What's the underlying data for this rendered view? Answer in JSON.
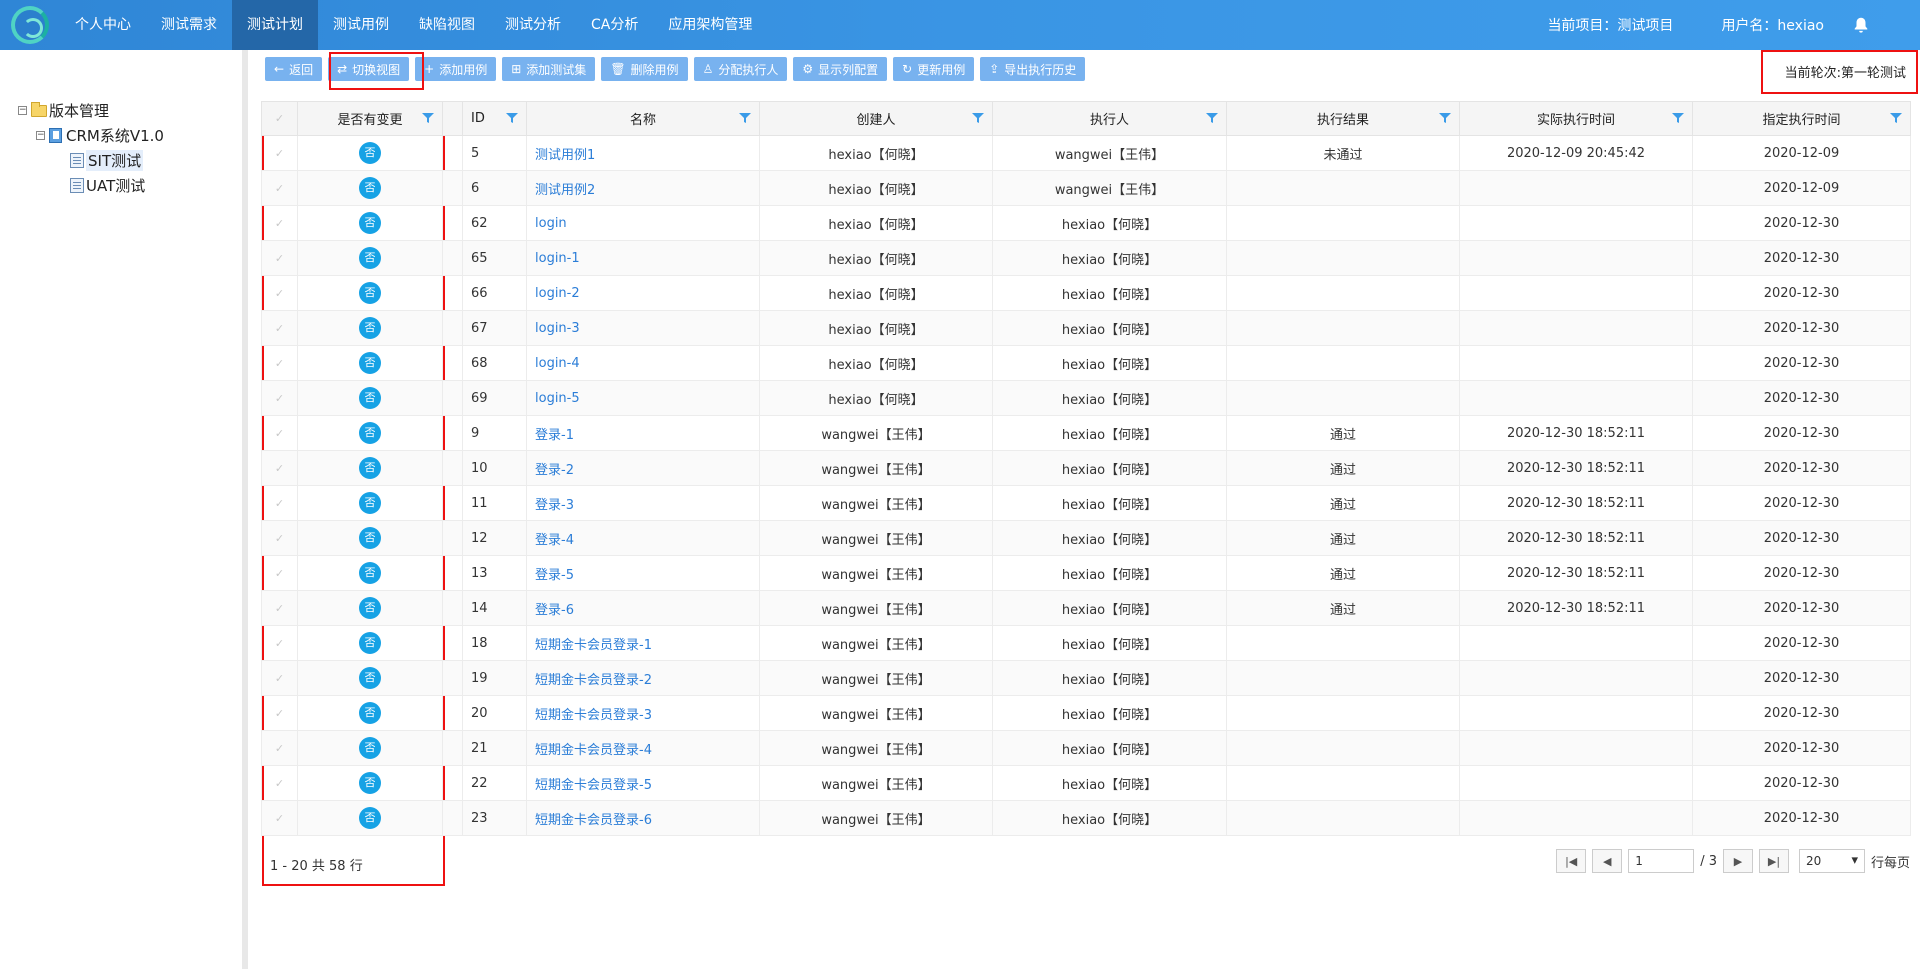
{
  "nav": {
    "items": [
      "个人中心",
      "测试需求",
      "测试计划",
      "测试用例",
      "缺陷视图",
      "测试分析",
      "CA分析",
      "应用架构管理"
    ],
    "active_index": 2,
    "project": "当前项目：测试项目",
    "user": "用户名：hexiao"
  },
  "tree": {
    "root": "版本管理",
    "version": "CRM系统V1.0",
    "children": [
      "SIT测试",
      "UAT测试"
    ]
  },
  "toolbar": {
    "buttons": [
      {
        "icon": "back-arrow-icon",
        "label": "返回"
      },
      {
        "icon": "switch-icon",
        "label": "切换视图"
      },
      {
        "icon": "plus-icon",
        "label": "添加用例"
      },
      {
        "icon": "add-set-icon",
        "label": "添加测试集"
      },
      {
        "icon": "trash-icon",
        "label": "删除用例"
      },
      {
        "icon": "user-icon",
        "label": "分配执行人"
      },
      {
        "icon": "gear-icon",
        "label": "显示列配置"
      },
      {
        "icon": "refresh-icon",
        "label": "更新用例"
      },
      {
        "icon": "upload-icon",
        "label": "导出执行历史"
      }
    ]
  },
  "round": "当前轮次:第一轮测试",
  "table": {
    "headers": [
      "是否有变更",
      "ID",
      "名称",
      "创建人",
      "执行人",
      "执行结果",
      "实际执行时间",
      "指定执行时间"
    ],
    "rows": [
      {
        "changed": "否",
        "id": "5",
        "name": "测试用例1",
        "creator": "hexiao【何晓】",
        "executor": "wangwei【王伟】",
        "result": "未通过",
        "actual": "2020-12-09 20:45:42",
        "planned": "2020-12-09"
      },
      {
        "changed": "否",
        "id": "6",
        "name": "测试用例2",
        "creator": "hexiao【何晓】",
        "executor": "wangwei【王伟】",
        "result": "",
        "actual": "",
        "planned": "2020-12-09"
      },
      {
        "changed": "否",
        "id": "62",
        "name": "login",
        "creator": "hexiao【何晓】",
        "executor": "hexiao【何晓】",
        "result": "",
        "actual": "",
        "planned": "2020-12-30"
      },
      {
        "changed": "否",
        "id": "65",
        "name": "login-1",
        "creator": "hexiao【何晓】",
        "executor": "hexiao【何晓】",
        "result": "",
        "actual": "",
        "planned": "2020-12-30"
      },
      {
        "changed": "否",
        "id": "66",
        "name": "login-2",
        "creator": "hexiao【何晓】",
        "executor": "hexiao【何晓】",
        "result": "",
        "actual": "",
        "planned": "2020-12-30"
      },
      {
        "changed": "否",
        "id": "67",
        "name": "login-3",
        "creator": "hexiao【何晓】",
        "executor": "hexiao【何晓】",
        "result": "",
        "actual": "",
        "planned": "2020-12-30"
      },
      {
        "changed": "否",
        "id": "68",
        "name": "login-4",
        "creator": "hexiao【何晓】",
        "executor": "hexiao【何晓】",
        "result": "",
        "actual": "",
        "planned": "2020-12-30"
      },
      {
        "changed": "否",
        "id": "69",
        "name": "login-5",
        "creator": "hexiao【何晓】",
        "executor": "hexiao【何晓】",
        "result": "",
        "actual": "",
        "planned": "2020-12-30"
      },
      {
        "changed": "否",
        "id": "9",
        "name": "登录-1",
        "creator": "wangwei【王伟】",
        "executor": "hexiao【何晓】",
        "result": "通过",
        "actual": "2020-12-30 18:52:11",
        "planned": "2020-12-30"
      },
      {
        "changed": "否",
        "id": "10",
        "name": "登录-2",
        "creator": "wangwei【王伟】",
        "executor": "hexiao【何晓】",
        "result": "通过",
        "actual": "2020-12-30 18:52:11",
        "planned": "2020-12-30"
      },
      {
        "changed": "否",
        "id": "11",
        "name": "登录-3",
        "creator": "wangwei【王伟】",
        "executor": "hexiao【何晓】",
        "result": "通过",
        "actual": "2020-12-30 18:52:11",
        "planned": "2020-12-30"
      },
      {
        "changed": "否",
        "id": "12",
        "name": "登录-4",
        "creator": "wangwei【王伟】",
        "executor": "hexiao【何晓】",
        "result": "通过",
        "actual": "2020-12-30 18:52:11",
        "planned": "2020-12-30"
      },
      {
        "changed": "否",
        "id": "13",
        "name": "登录-5",
        "creator": "wangwei【王伟】",
        "executor": "hexiao【何晓】",
        "result": "通过",
        "actual": "2020-12-30 18:52:11",
        "planned": "2020-12-30"
      },
      {
        "changed": "否",
        "id": "14",
        "name": "登录-6",
        "creator": "wangwei【王伟】",
        "executor": "hexiao【何晓】",
        "result": "通过",
        "actual": "2020-12-30 18:52:11",
        "planned": "2020-12-30"
      },
      {
        "changed": "否",
        "id": "18",
        "name": "短期金卡会员登录-1",
        "creator": "wangwei【王伟】",
        "executor": "hexiao【何晓】",
        "result": "",
        "actual": "",
        "planned": "2020-12-30"
      },
      {
        "changed": "否",
        "id": "19",
        "name": "短期金卡会员登录-2",
        "creator": "wangwei【王伟】",
        "executor": "hexiao【何晓】",
        "result": "",
        "actual": "",
        "planned": "2020-12-30"
      },
      {
        "changed": "否",
        "id": "20",
        "name": "短期金卡会员登录-3",
        "creator": "wangwei【王伟】",
        "executor": "hexiao【何晓】",
        "result": "",
        "actual": "",
        "planned": "2020-12-30"
      },
      {
        "changed": "否",
        "id": "21",
        "name": "短期金卡会员登录-4",
        "creator": "wangwei【王伟】",
        "executor": "hexiao【何晓】",
        "result": "",
        "actual": "",
        "planned": "2020-12-30"
      },
      {
        "changed": "否",
        "id": "22",
        "name": "短期金卡会员登录-5",
        "creator": "wangwei【王伟】",
        "executor": "hexiao【何晓】",
        "result": "",
        "actual": "",
        "planned": "2020-12-30"
      },
      {
        "changed": "否",
        "id": "23",
        "name": "短期金卡会员登录-6",
        "creator": "wangwei【王伟】",
        "executor": "hexiao【何晓】",
        "result": "",
        "actual": "",
        "planned": "2020-12-30"
      }
    ]
  },
  "pagination": {
    "info": "1 - 20 共 58 行",
    "current_page": "1",
    "total_pages": "/ 3",
    "page_size": "20",
    "page_size_suffix": "行每页"
  },
  "colors": {
    "nav_bg": "#3a95e4",
    "nav_active": "#2467a8",
    "button": "#78b2ef",
    "link": "#2b7dd7",
    "badge": "#16a2e5",
    "highlight_box": "#e11111"
  }
}
